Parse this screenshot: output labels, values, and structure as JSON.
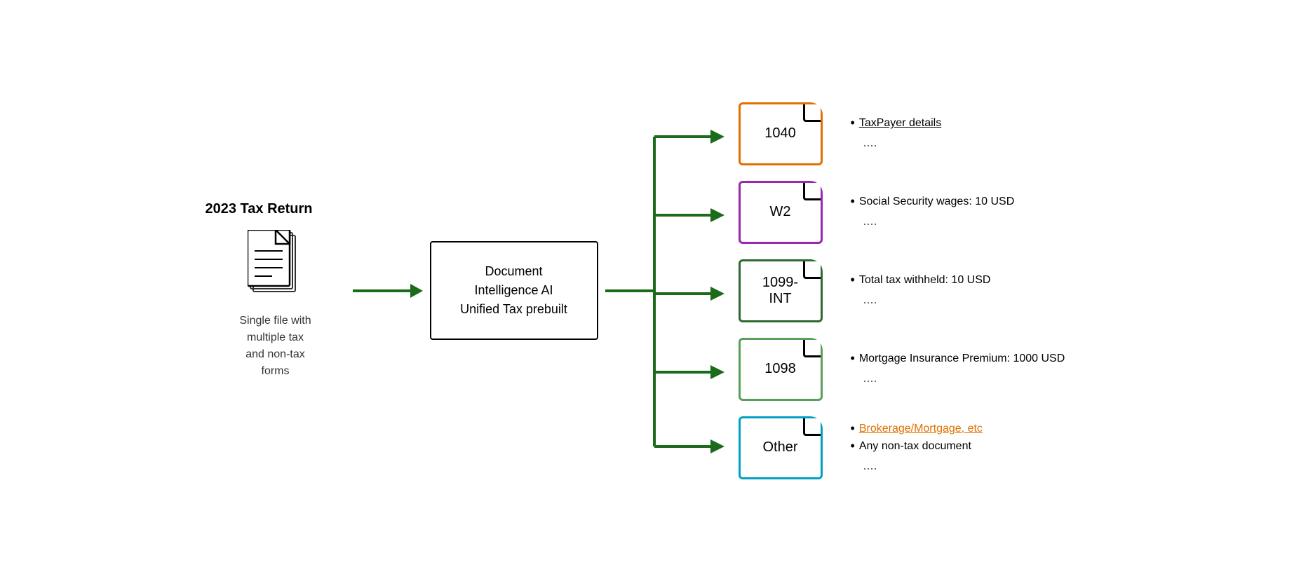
{
  "left": {
    "title": "2023 Tax Return",
    "label": "Single file with\nmultiple tax\nand non-tax\nforms"
  },
  "center": {
    "line1": "Document Intelligence AI",
    "line2": "Unified Tax prebuilt"
  },
  "forms": [
    {
      "id": "1040",
      "label": "1040",
      "color": "orange"
    },
    {
      "id": "W2",
      "label": "W2",
      "color": "purple"
    },
    {
      "id": "1099-INT",
      "label": "1099-\nINT",
      "color": "dark-green"
    },
    {
      "id": "1098",
      "label": "1098",
      "color": "light-green"
    },
    {
      "id": "Other",
      "label": "Other",
      "color": "cyan"
    }
  ],
  "info_blocks": [
    {
      "bullets": [
        "TaxPayer details"
      ],
      "dots": "...."
    },
    {
      "bullets": [
        "Social Security wages: 10 USD"
      ],
      "dots": "...."
    },
    {
      "bullets": [
        "Total tax withheld: 10 USD"
      ],
      "dots": "...."
    },
    {
      "bullets": [
        "Mortgage Insurance Premium: 1000 USD"
      ],
      "dots": "...."
    },
    {
      "bullets": [
        "Brokerage/Mortgage, etc",
        "Any non-tax document"
      ],
      "dots": "...."
    }
  ],
  "colors": {
    "arrow": "#1a6b1a",
    "orange": "#E07000",
    "purple": "#9B27AF",
    "dark_green": "#2D6A2D",
    "light_green": "#5A9E5A",
    "cyan": "#00A0C0"
  }
}
